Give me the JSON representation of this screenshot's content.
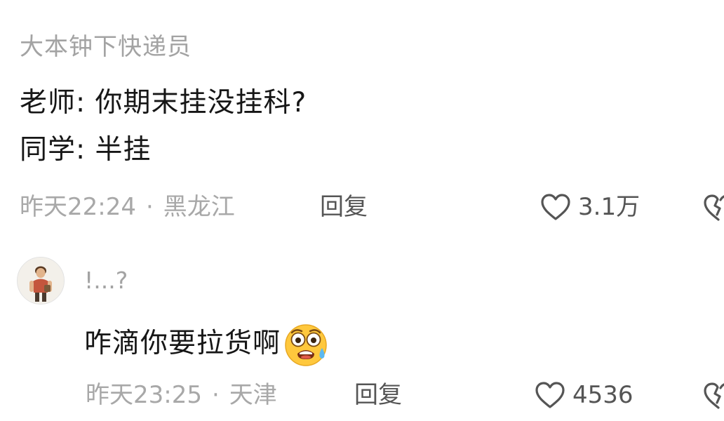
{
  "comment": {
    "username": "大本钟下快递员",
    "lines": [
      "老师: 你期末挂没挂科?",
      "同学: 半挂"
    ],
    "time": "昨天22:24",
    "separator": "·",
    "location": "黑龙江",
    "reply_label": "回复",
    "like_count": "3.1万"
  },
  "reply": {
    "username": "!...?",
    "text": "咋滴你要拉货啊",
    "emoji": "shocked-sweat-emoji",
    "time": "昨天23:25",
    "separator": "·",
    "location": "天津",
    "reply_label": "回复",
    "like_count": "4536"
  },
  "colors": {
    "primary_text": "#161616",
    "secondary_text": "#a3a3a3",
    "action_text": "#555555",
    "icon_stroke": "#555555",
    "emoji_face": "#ffc83d"
  }
}
